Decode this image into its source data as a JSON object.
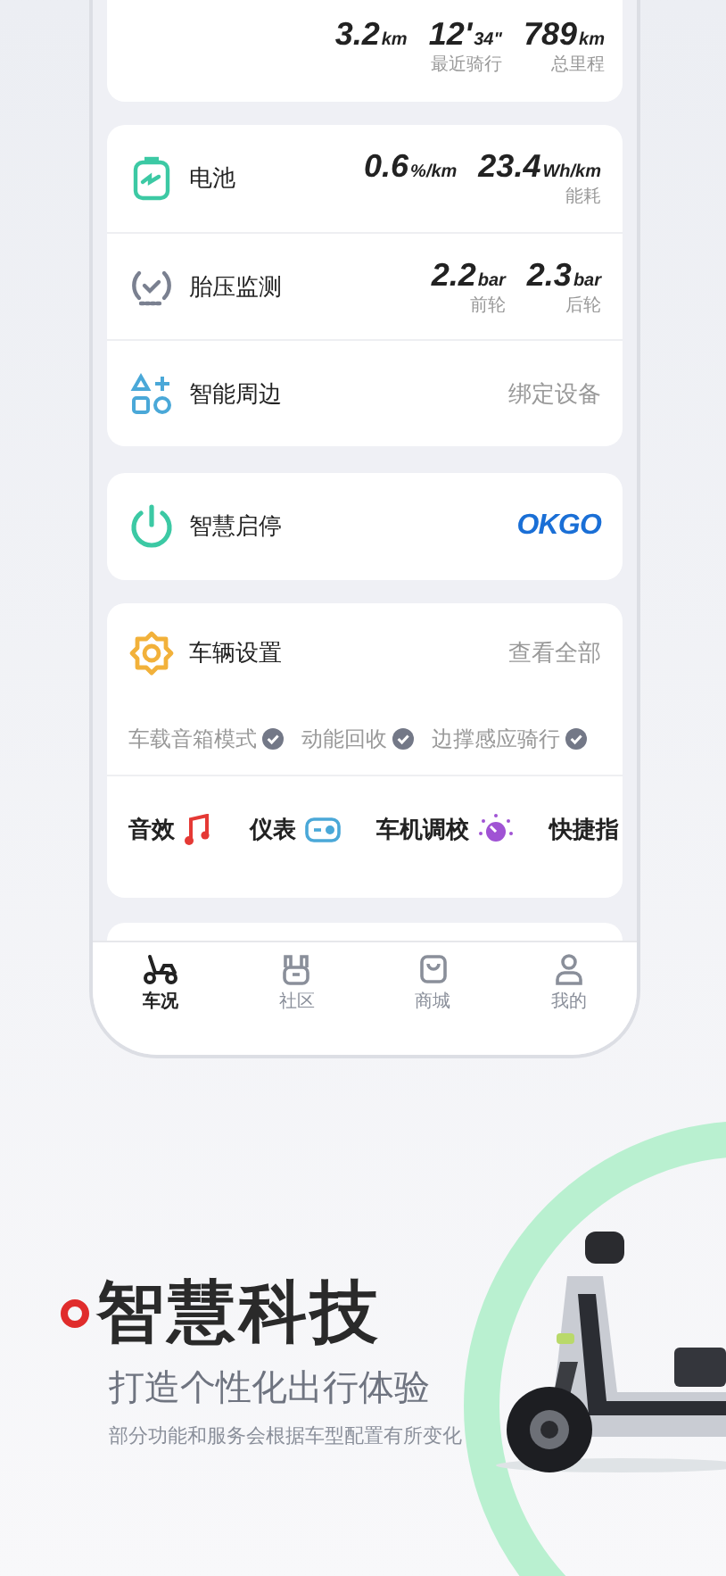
{
  "summary": {
    "stats": [
      {
        "value": "3.2",
        "unit": "km"
      },
      {
        "value": "12'",
        "unit": "34\"",
        "label": "最近骑行"
      },
      {
        "value": "789",
        "unit": "km",
        "label": "总里程"
      }
    ]
  },
  "status_card": {
    "rows": [
      {
        "kind": "battery",
        "title": "电池",
        "readings": [
          {
            "value": "0.6",
            "unit": "%/km"
          },
          {
            "value": "23.4",
            "unit": "Wh/km",
            "label": "能耗"
          }
        ]
      },
      {
        "kind": "tire",
        "title": "胎压监测",
        "readings": [
          {
            "value": "2.2",
            "unit": "bar",
            "label": "前轮"
          },
          {
            "value": "2.3",
            "unit": "bar",
            "label": "后轮"
          }
        ]
      },
      {
        "kind": "devices",
        "title": "智能周边",
        "action": "绑定设备"
      }
    ]
  },
  "smart_start": {
    "title": "智慧启停",
    "logo": "OKGO"
  },
  "vehicle_settings": {
    "title": "车辆设置",
    "action": "查看全部",
    "features": [
      {
        "label": "车载音箱模式",
        "checked": true
      },
      {
        "label": "动能回收",
        "checked": true
      },
      {
        "label": "边撑感应骑行",
        "checked": true
      }
    ],
    "shortcuts": [
      {
        "kind": "sound",
        "label": "音效"
      },
      {
        "kind": "dashboard",
        "label": "仪表"
      },
      {
        "kind": "tuning",
        "label": "车机调校"
      },
      {
        "kind": "shortcut",
        "label": "快捷指"
      }
    ]
  },
  "tab_bar": [
    {
      "kind": "vehicle",
      "label": "车况",
      "selected": true
    },
    {
      "kind": "community",
      "label": "社区",
      "selected": false
    },
    {
      "kind": "shop",
      "label": "商城",
      "selected": false
    },
    {
      "kind": "me",
      "label": "我的",
      "selected": false
    }
  ],
  "promo": {
    "headline": "智慧科技",
    "subtitle": "打造个性化出行体验",
    "note": "部分功能和服务会根据车型配置有所变化"
  }
}
